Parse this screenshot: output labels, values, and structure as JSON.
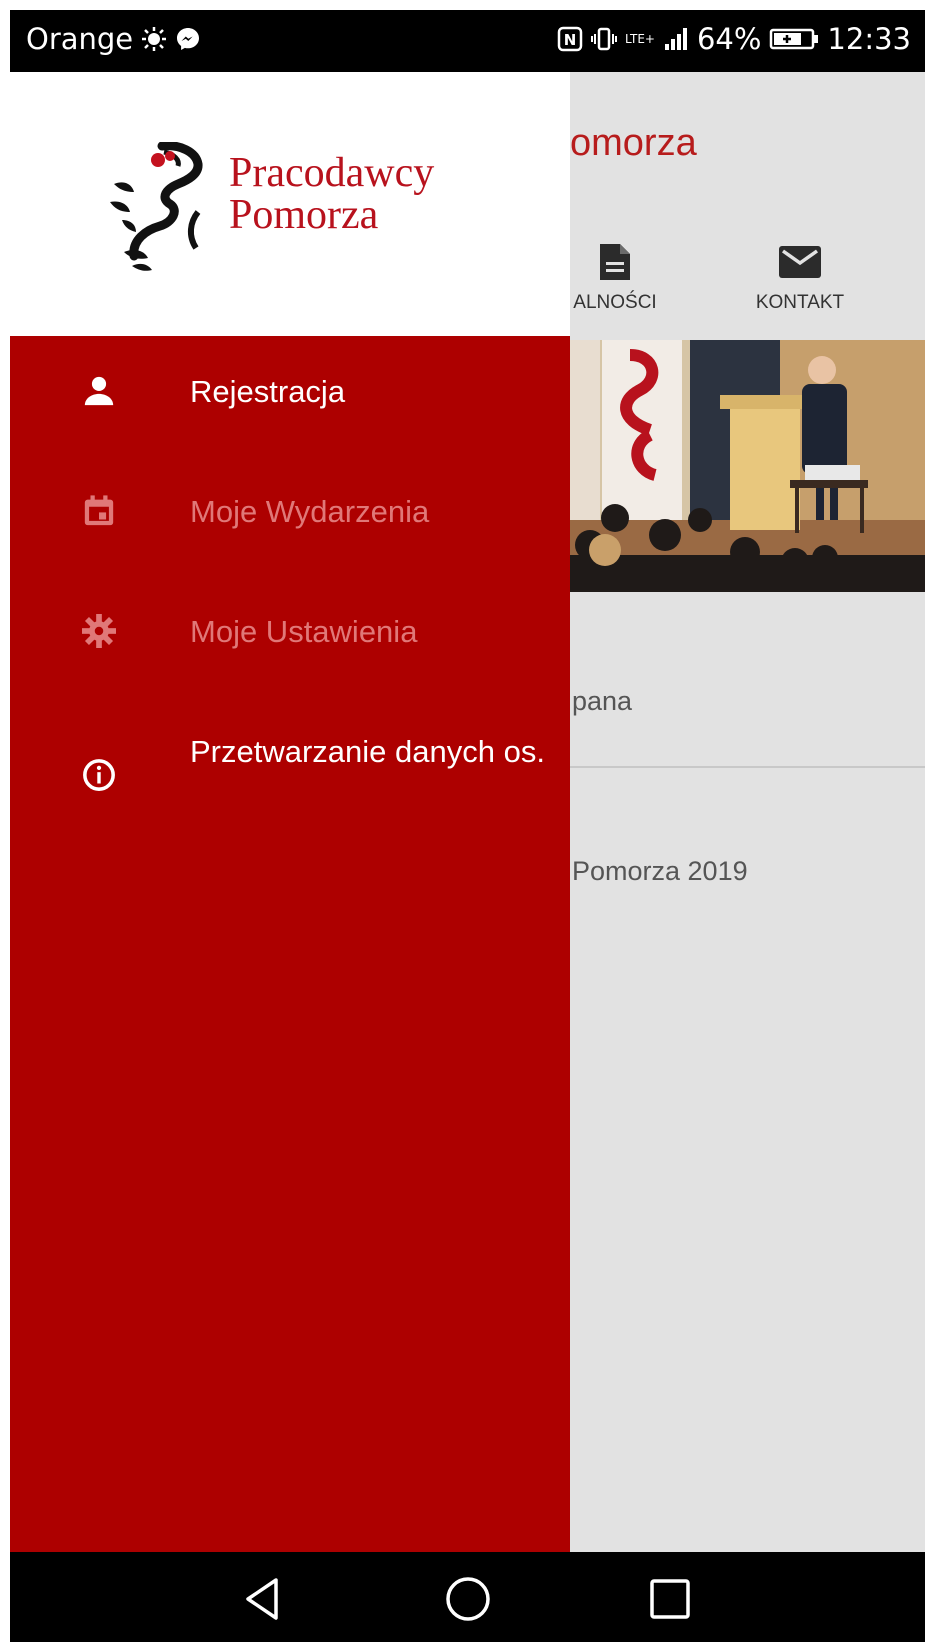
{
  "status_bar": {
    "carrier": "Orange",
    "network": "LTE+",
    "battery": "64%",
    "time": "12:33"
  },
  "background_app": {
    "title": "omorza",
    "nav_items": [
      {
        "label": "ALNOŚCI",
        "icon": "document-icon"
      },
      {
        "label": "KONTAKT",
        "icon": "mail-icon"
      }
    ],
    "text_line_1": "pana",
    "text_line_2": "Pomorza 2019"
  },
  "drawer": {
    "logo": {
      "line1": "Pracodawcy",
      "line2": "Pomorza",
      "color": "#b8121d"
    },
    "background_color": "#ad0000",
    "items": [
      {
        "label": "Rejestracja",
        "icon": "person-icon",
        "state": "active"
      },
      {
        "label": "Moje Wydarzenia",
        "icon": "calendar-icon",
        "state": "disabled"
      },
      {
        "label": "Moje Ustawienia",
        "icon": "gear-icon",
        "state": "disabled"
      },
      {
        "label": "Przetwarzanie danych os.",
        "icon": "info-icon",
        "state": "active"
      }
    ]
  },
  "nav_bar": {
    "buttons": [
      "back-icon",
      "home-icon",
      "recents-icon"
    ]
  }
}
